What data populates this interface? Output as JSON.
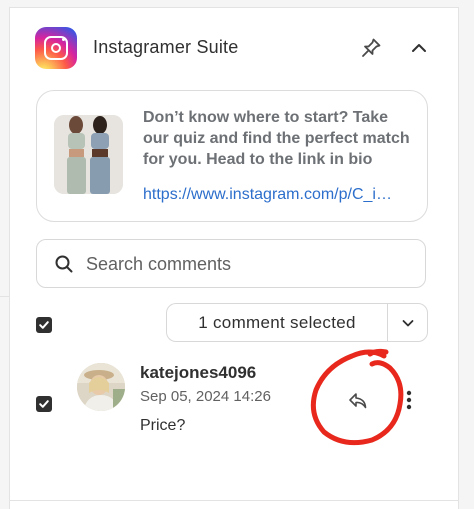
{
  "app": {
    "title": "Instagramer Suite",
    "icon": "instagram-logo",
    "actions": [
      "pin-icon",
      "chevron-up-icon"
    ]
  },
  "post": {
    "caption": "Don’t know where to start? Take our quiz and find the perfect match for you. Head to the link in bio",
    "link": "https://www.instagram.com/p/C_i…"
  },
  "search": {
    "placeholder": "Search comments",
    "value": ""
  },
  "bulk": {
    "select_all_checked": true,
    "selected_label": "1 comment selected",
    "dropdown_icon": "chevron-down-icon"
  },
  "comments": [
    {
      "checked": true,
      "username": "katejones4096",
      "timestamp": "Sep 05, 2024 14:26",
      "text": "Price?",
      "actions": [
        "reply-icon",
        "more-vertical-icon"
      ]
    }
  ],
  "colors": {
    "link": "#2c6ecb",
    "annotation": "#e8281c",
    "checkbox": "#303030"
  }
}
